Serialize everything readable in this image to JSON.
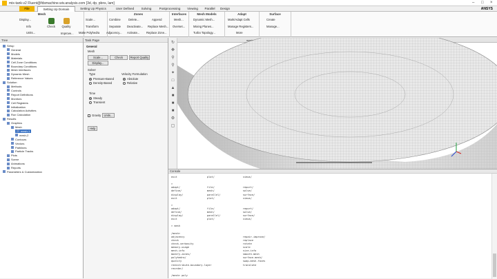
{
  "window": {
    "title": "mix-tank-v2 Fluent@fdsmachine.wiv.analysis.com [3d, dp, pbns, lam]"
  },
  "menu": {
    "file": "File",
    "tabs": [
      "Setting Up Domain",
      "Setting Up Physics",
      "User Defined",
      "Solving",
      "Postprocessing",
      "Viewing",
      "Parallel",
      "Design"
    ],
    "logo": "ANSYS"
  },
  "ribbon": {
    "mesh": {
      "title": "Mesh",
      "display": "Display...",
      "info": "Info",
      "units": "Units...",
      "check": "Check",
      "quality": "Quality",
      "scale": "Scale...",
      "transform": "Transform",
      "improve": "Improve...",
      "make_polyhedra": "Make Polyhedra"
    },
    "zones": {
      "title": "Zones",
      "combine": "Combine",
      "separate": "Separate",
      "adjacency": "Adjacency...",
      "delete": "Delete...",
      "deactivate": "Deactivate...",
      "activate": "Activate...",
      "append": "Append",
      "replace_mesh": "Replace Mesh...",
      "replace_zone": "Replace Zone..."
    },
    "interfaces": {
      "title": "Interfaces",
      "mesh": "Mesh...",
      "overset": "Overset..."
    },
    "mesh_models": {
      "title": "Mesh Models",
      "dynamic_mesh": "Dynamic Mesh...",
      "mixing_planes": "Mixing Planes...",
      "turbo_topology": "Turbo Topology..."
    },
    "adapt": {
      "title": "Adapt",
      "mark_adapt": "Mark/Adapt Cells",
      "manage_registers": "Manage Registers...",
      "more": "More"
    },
    "surface": {
      "title": "Surface",
      "create": "Create",
      "manage": "Manage..."
    }
  },
  "tree": {
    "header": "Tree",
    "items": [
      "Setup",
      "General",
      "Models",
      "Materials",
      "Cell Zone Conditions",
      "Boundary Conditions",
      "Mesh Interfaces",
      "Dynamic Mesh",
      "Reference Values",
      "Solution",
      "Methods",
      "Controls",
      "Report Definitions",
      "Monitors",
      "Cell Registers",
      "Initialization",
      "Calculation Activities",
      "Run Calculation",
      "Results",
      "Graphics",
      "Mesh",
      "mesh-1",
      "mesh-2",
      "Contours",
      "Vectors",
      "Pathlines",
      "Particle Tracks",
      "Plots",
      "Scene",
      "Animations",
      "Reports",
      "Parameters & Customization"
    ]
  },
  "task_page": {
    "header": "Task Page",
    "general": "General",
    "mesh_label": "Mesh",
    "scale": "Scale...",
    "check": "Check",
    "report_quality": "Report Quality",
    "display": "Display...",
    "solver": "Solver",
    "type": "Type",
    "pressure_based": "Pressure-Based",
    "density_based": "Density-Based",
    "velocity_formulation": "Velocity Formulation",
    "absolute": "Absolute",
    "relative": "Relative",
    "time": "Time",
    "steady": "Steady",
    "transient": "Transient",
    "gravity": "Gravity",
    "units": "Units...",
    "help": "Help"
  },
  "graphics": {
    "tab": "mesh-1"
  },
  "console": {
    "header": "Console",
    "lines": [
      "exit                    plot/                   views/",
      "",
      ">",
      "adapt/                  file/                   report/",
      "define/                 mesh/                   solve/",
      "display/                parallel/               surface/",
      "exit                    plot/                   views/",
      "",
      ">",
      "adapt/                  file/                   report/",
      "define/                 mesh/                   solve/",
      "display/                parallel/               surface/",
      "exit                    plot/                   views/",
      "",
      "> mesh",
      "",
      "/mesh>",
      "adjacency                                       repair-improve/",
      "check                                           replace",
      "check-verbosity                                 rotate",
      "memory-usage                                    scale",
      "mesh-info                                       size-info",
      "modify-zones/                                   smooth-mesh",
      "polyhedra/                                      surface-mesh/",
      "quality                                         swap-mesh-faces",
      "redistribute-boundary-layer                     translate",
      "reorder/",
      "",
      "/mesh> poly"
    ]
  }
}
